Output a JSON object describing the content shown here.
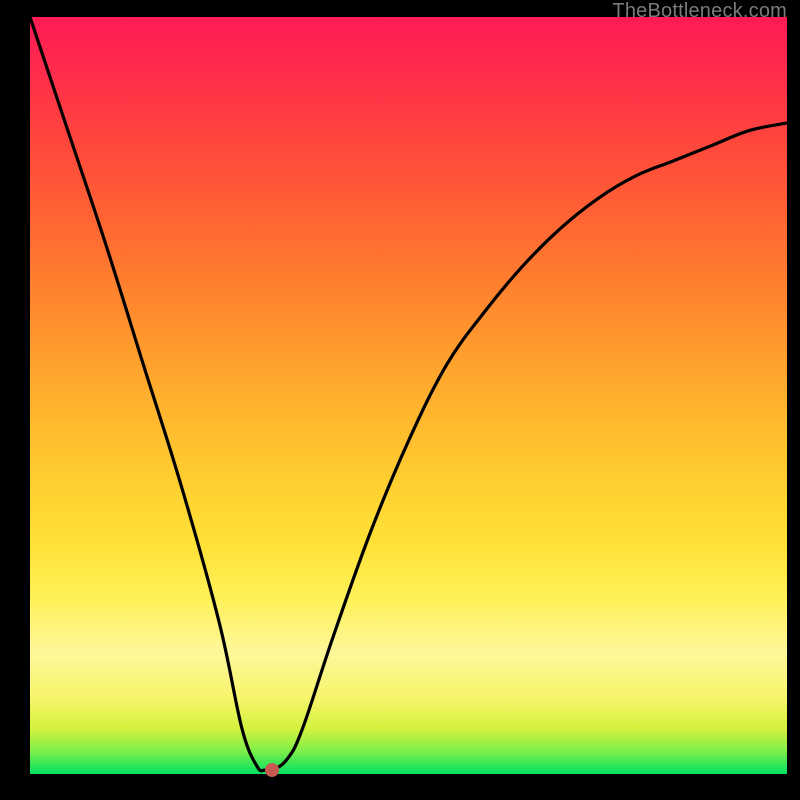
{
  "watermark": "TheBottleneck.com",
  "chart_data": {
    "type": "line",
    "title": "",
    "xlabel": "",
    "ylabel": "",
    "xlim": [
      0,
      100
    ],
    "ylim": [
      0,
      100
    ],
    "series": [
      {
        "name": "curve",
        "x": [
          0,
          5,
          10,
          15,
          20,
          25,
          28,
          30,
          31,
          32,
          34,
          36,
          40,
          45,
          50,
          55,
          60,
          65,
          70,
          75,
          80,
          85,
          90,
          95,
          100
        ],
        "values": [
          100,
          85,
          70,
          54,
          38,
          20,
          6,
          1,
          0.5,
          0.5,
          2,
          6,
          18,
          32,
          44,
          54,
          61,
          67,
          72,
          76,
          79,
          81,
          83,
          85,
          86
        ]
      }
    ],
    "marker": {
      "x": 32,
      "y": 0.5
    },
    "colors": {
      "curve_stroke": "#000000",
      "marker_fill": "#c75b52",
      "gradient_top": "#ff1a55",
      "gradient_bottom": "#00e060"
    }
  }
}
